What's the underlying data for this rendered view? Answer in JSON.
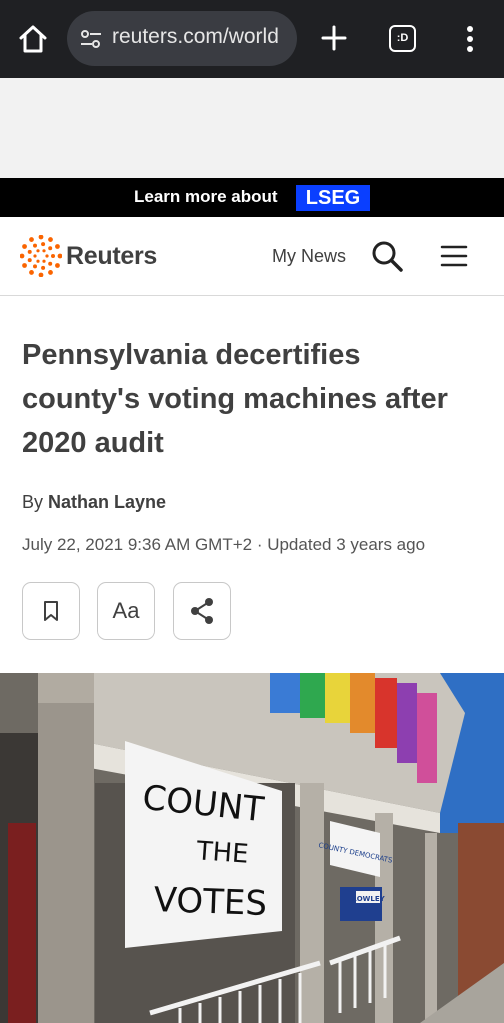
{
  "browser": {
    "url": "reuters.com/world",
    "tabs_badge": ":D",
    "icons": [
      "home-icon",
      "site-settings-icon",
      "new-tab-plus-icon",
      "tab-switcher-icon",
      "more-vert-icon"
    ]
  },
  "promo": {
    "text": "Learn more about",
    "badge": "LSEG",
    "badge_color": "#0a3fff"
  },
  "site": {
    "logo_text": "Reuters",
    "nav_mynews": "My News",
    "logo_color": "#fa6400"
  },
  "article": {
    "headline": "Pennsylvania decertifies county's voting machines after 2020 audit",
    "byline_prefix": "By",
    "author": "Nathan Layne",
    "date": "July 22, 2021 9:36 AM GMT+2 · Updated 3 years ago",
    "text_size_label": "Aa"
  },
  "photo": {
    "sign_lines": [
      "COUNT",
      "THE",
      "VOTES"
    ],
    "banner_text": "COUNTY DEMOCRATS",
    "poster_text": "ROWLEY"
  }
}
